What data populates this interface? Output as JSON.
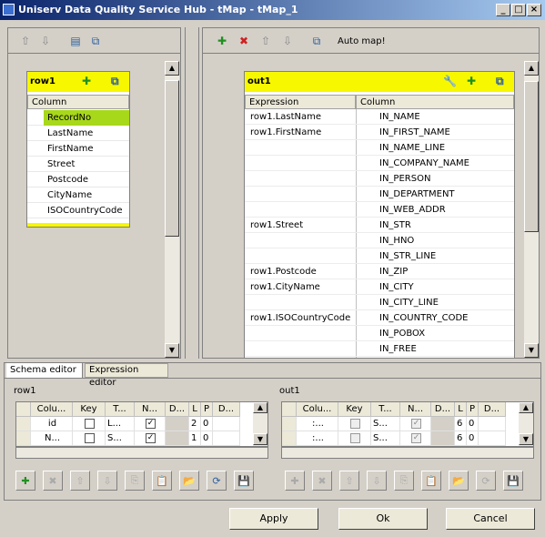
{
  "window": {
    "title": "Uniserv Data Quality Service Hub - tMap - tMap_1"
  },
  "left_panel": {
    "table_name": "row1",
    "column_header": "Column",
    "columns": [
      "RecordNo",
      "LastName",
      "FirstName",
      "Street",
      "Postcode",
      "CityName",
      "ISOCountryCode"
    ],
    "selected_index": 0
  },
  "right_panel": {
    "toolbar_label": "Auto map!",
    "table_name": "out1",
    "headers": {
      "expression": "Expression",
      "column": "Column"
    },
    "rows": [
      {
        "expression": "row1.LastName",
        "column": "IN_NAME"
      },
      {
        "expression": "row1.FirstName",
        "column": "IN_FIRST_NAME"
      },
      {
        "expression": "",
        "column": "IN_NAME_LINE"
      },
      {
        "expression": "",
        "column": "IN_COMPANY_NAME"
      },
      {
        "expression": "",
        "column": "IN_PERSON"
      },
      {
        "expression": "",
        "column": "IN_DEPARTMENT"
      },
      {
        "expression": "",
        "column": "IN_WEB_ADDR"
      },
      {
        "expression": "row1.Street",
        "column": "IN_STR"
      },
      {
        "expression": "",
        "column": "IN_HNO"
      },
      {
        "expression": "",
        "column": "IN_STR_LINE"
      },
      {
        "expression": "row1.Postcode",
        "column": "IN_ZIP"
      },
      {
        "expression": "row1.CityName",
        "column": "IN_CITY"
      },
      {
        "expression": "",
        "column": "IN_CITY_LINE"
      },
      {
        "expression": "row1.ISOCountryCode",
        "column": "IN_COUNTRY_CODE"
      },
      {
        "expression": "",
        "column": "IN_POBOX"
      },
      {
        "expression": "",
        "column": "IN_FREE"
      }
    ]
  },
  "tabs": {
    "schema_editor": "Schema editor",
    "expression_editor": "Expression editor"
  },
  "schema_left": {
    "title": "row1",
    "headers": [
      "Colu...",
      "Key",
      "T...",
      "N...",
      "D...",
      "L",
      "P",
      "D..."
    ],
    "rows": [
      {
        "col": "id",
        "key": false,
        "type": "L...",
        "nullable": true,
        "length": "2",
        "precision": "0"
      },
      {
        "col": "N...",
        "key": false,
        "type": "S...",
        "nullable": true,
        "length": "1",
        "precision": "0"
      }
    ]
  },
  "schema_right": {
    "title": "out1",
    "headers": [
      "Colu...",
      "Key",
      "T...",
      "N...",
      "D...",
      "L",
      "P",
      "D..."
    ],
    "rows": [
      {
        "col": ":...",
        "key": false,
        "type": "S...",
        "nullable": true,
        "length": "6",
        "precision": "0"
      },
      {
        "col": ":...",
        "key": false,
        "type": "S...",
        "nullable": true,
        "length": "6",
        "precision": "0"
      }
    ]
  },
  "buttons": {
    "apply": "Apply",
    "ok": "Ok",
    "cancel": "Cancel"
  }
}
